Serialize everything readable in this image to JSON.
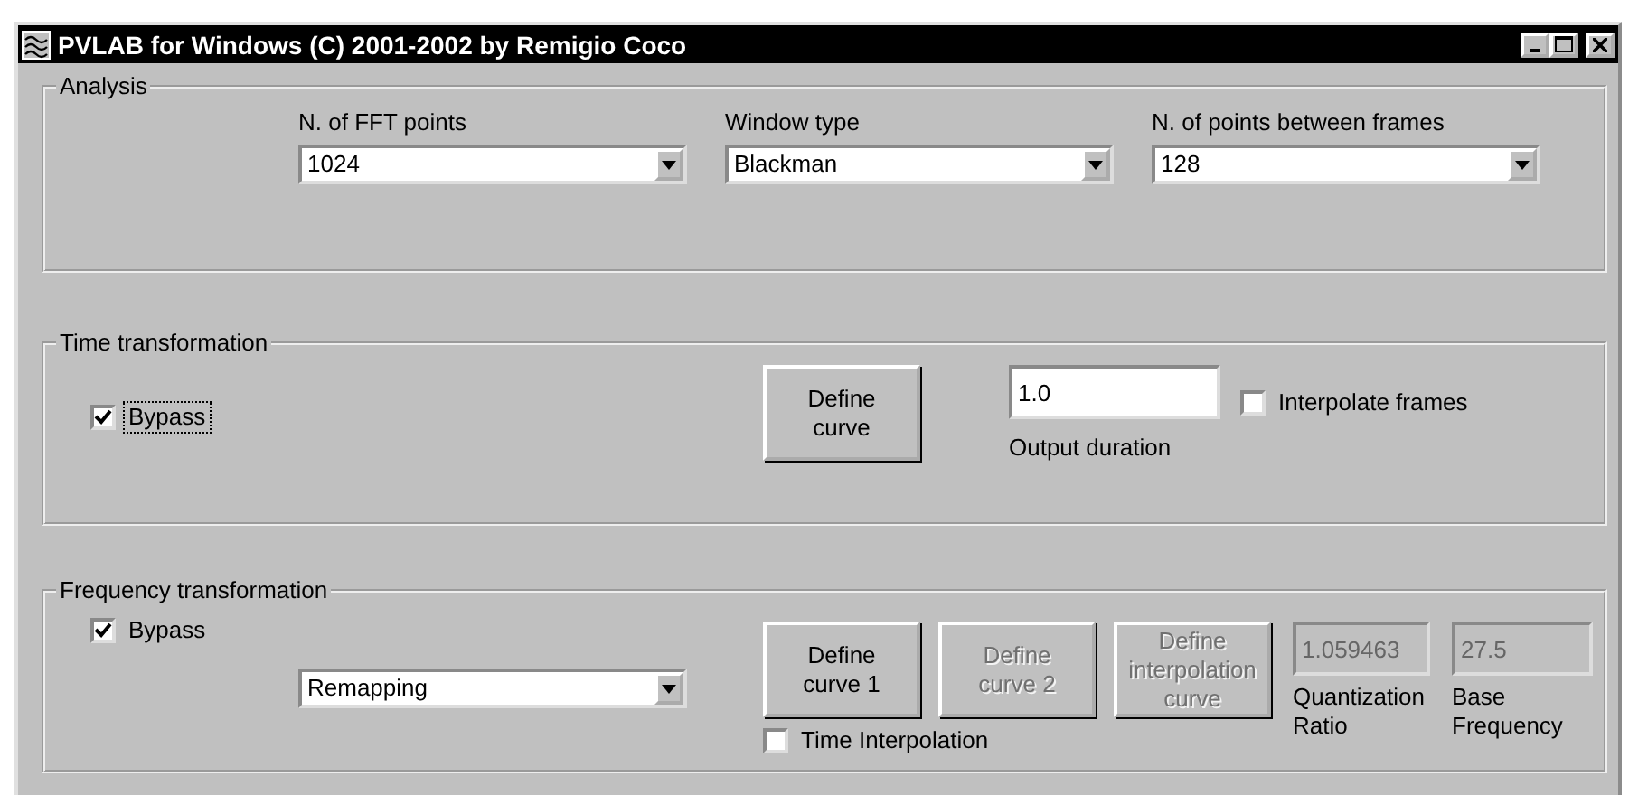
{
  "window": {
    "title": "PVLAB for Windows (C) 2001-2002 by Remigio Coco"
  },
  "analysis": {
    "title": "Analysis",
    "dropdowns": [
      {
        "label": "N. of FFT points",
        "value": "1024"
      },
      {
        "label": "Window type",
        "value": "Blackman"
      },
      {
        "label": "N. of points between frames",
        "value": "128"
      }
    ]
  },
  "time_transformation": {
    "title": "Time transformation",
    "bypass": {
      "label": "Bypass",
      "checked": true,
      "focused": true
    },
    "define_button": {
      "label": "Define\ncurve",
      "disabled": false
    },
    "output_duration": {
      "value": "1.0",
      "label": "Output duration"
    },
    "interpolate_frames": {
      "label": "Interpolate frames",
      "checked": false
    }
  },
  "frequency_transformation": {
    "title": "Frequency transformation",
    "bypass": {
      "label": "Bypass",
      "checked": true,
      "focused": false
    },
    "method_dropdown": {
      "value": "Remapping"
    },
    "buttons": [
      {
        "label": "Define\ncurve 1",
        "disabled": false
      },
      {
        "label": "Define\ncurve 2",
        "disabled": true
      },
      {
        "label": "Define\ninterpolation\ncurve",
        "disabled": true
      }
    ],
    "time_interpolation": {
      "label": "Time Interpolation",
      "checked": false
    },
    "fields": [
      {
        "value": "1.059463",
        "label": "Quantization\nRatio",
        "disabled": true
      },
      {
        "value": "27.5",
        "label": "Base\nFrequency",
        "disabled": true
      }
    ]
  }
}
